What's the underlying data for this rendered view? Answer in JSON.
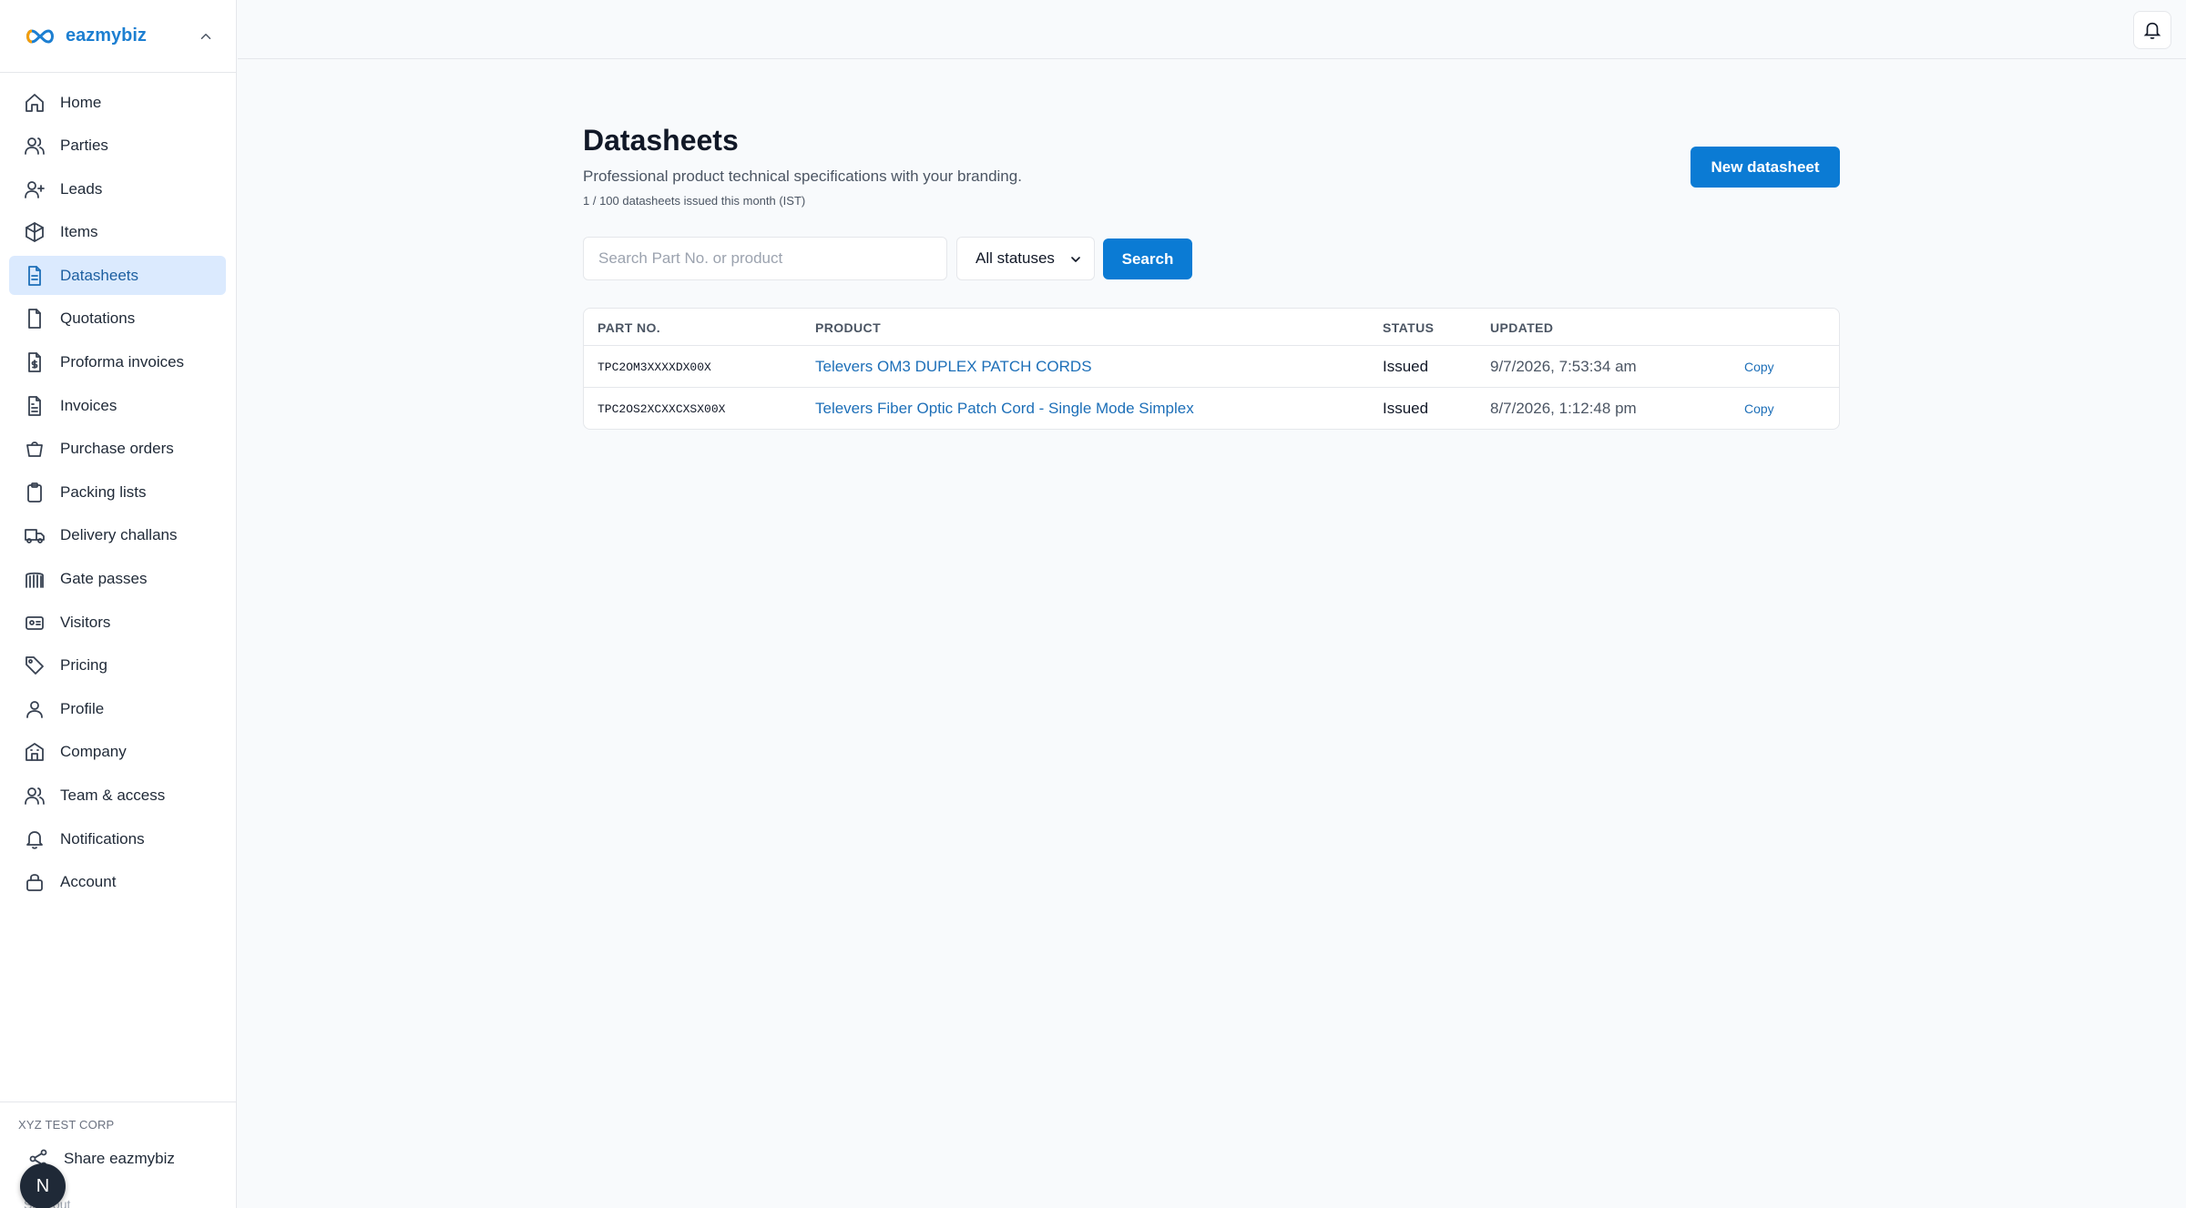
{
  "brand": {
    "name": "eazmybiz"
  },
  "sidebar": {
    "items": [
      {
        "label": "Home",
        "icon": "home-icon",
        "active": false
      },
      {
        "label": "Parties",
        "icon": "users-icon",
        "active": false
      },
      {
        "label": "Leads",
        "icon": "user-plus-icon",
        "active": false
      },
      {
        "label": "Items",
        "icon": "box-icon",
        "active": false
      },
      {
        "label": "Datasheets",
        "icon": "file-text-icon",
        "active": true
      },
      {
        "label": "Quotations",
        "icon": "file-icon",
        "active": false
      },
      {
        "label": "Proforma invoices",
        "icon": "file-dollar-icon",
        "active": false
      },
      {
        "label": "Invoices",
        "icon": "file-lines-icon",
        "active": false
      },
      {
        "label": "Purchase orders",
        "icon": "cart-icon",
        "active": false
      },
      {
        "label": "Packing lists",
        "icon": "clipboard-icon",
        "active": false
      },
      {
        "label": "Delivery challans",
        "icon": "truck-icon",
        "active": false
      },
      {
        "label": "Gate passes",
        "icon": "gate-icon",
        "active": false
      },
      {
        "label": "Visitors",
        "icon": "id-card-icon",
        "active": false
      },
      {
        "label": "Pricing",
        "icon": "tag-icon",
        "active": false
      },
      {
        "label": "Profile",
        "icon": "user-icon",
        "active": false
      },
      {
        "label": "Company",
        "icon": "building-icon",
        "active": false
      },
      {
        "label": "Team & access",
        "icon": "team-icon",
        "active": false
      },
      {
        "label": "Notifications",
        "icon": "bell-icon",
        "active": false
      },
      {
        "label": "Account",
        "icon": "lock-icon",
        "active": false
      }
    ],
    "org_name": "XYZ TEST CORP",
    "share_label": "Share eazmybiz",
    "signout_label": "Sign out",
    "avatar_initial": "N"
  },
  "page": {
    "title": "Datasheets",
    "subtitle": "Professional product technical specifications with your branding.",
    "quota": "1 / 100 datasheets issued this month (IST)",
    "new_button": "New datasheet"
  },
  "filters": {
    "search_placeholder": "Search Part No. or product",
    "status_value": "All statuses",
    "search_button": "Search"
  },
  "table": {
    "headers": {
      "part": "PART NO.",
      "product": "PRODUCT",
      "status": "STATUS",
      "updated": "UPDATED"
    },
    "rows": [
      {
        "part": "TPC2OM3XXXXDX00X",
        "product": "Televers OM3 DUPLEX PATCH CORDS",
        "status": "Issued",
        "updated": "9/7/2026, 7:53:34 am",
        "action": "Copy"
      },
      {
        "part": "TPC2OS2XCXXCXSX00X",
        "product": "Televers Fiber Optic Patch Cord - Single Mode Simplex",
        "status": "Issued",
        "updated": "8/7/2026, 1:12:48 pm",
        "action": "Copy"
      }
    ]
  },
  "colors": {
    "accent": "#0b7bd4",
    "active_bg": "#dbeafe",
    "link": "#1d6fb8"
  }
}
